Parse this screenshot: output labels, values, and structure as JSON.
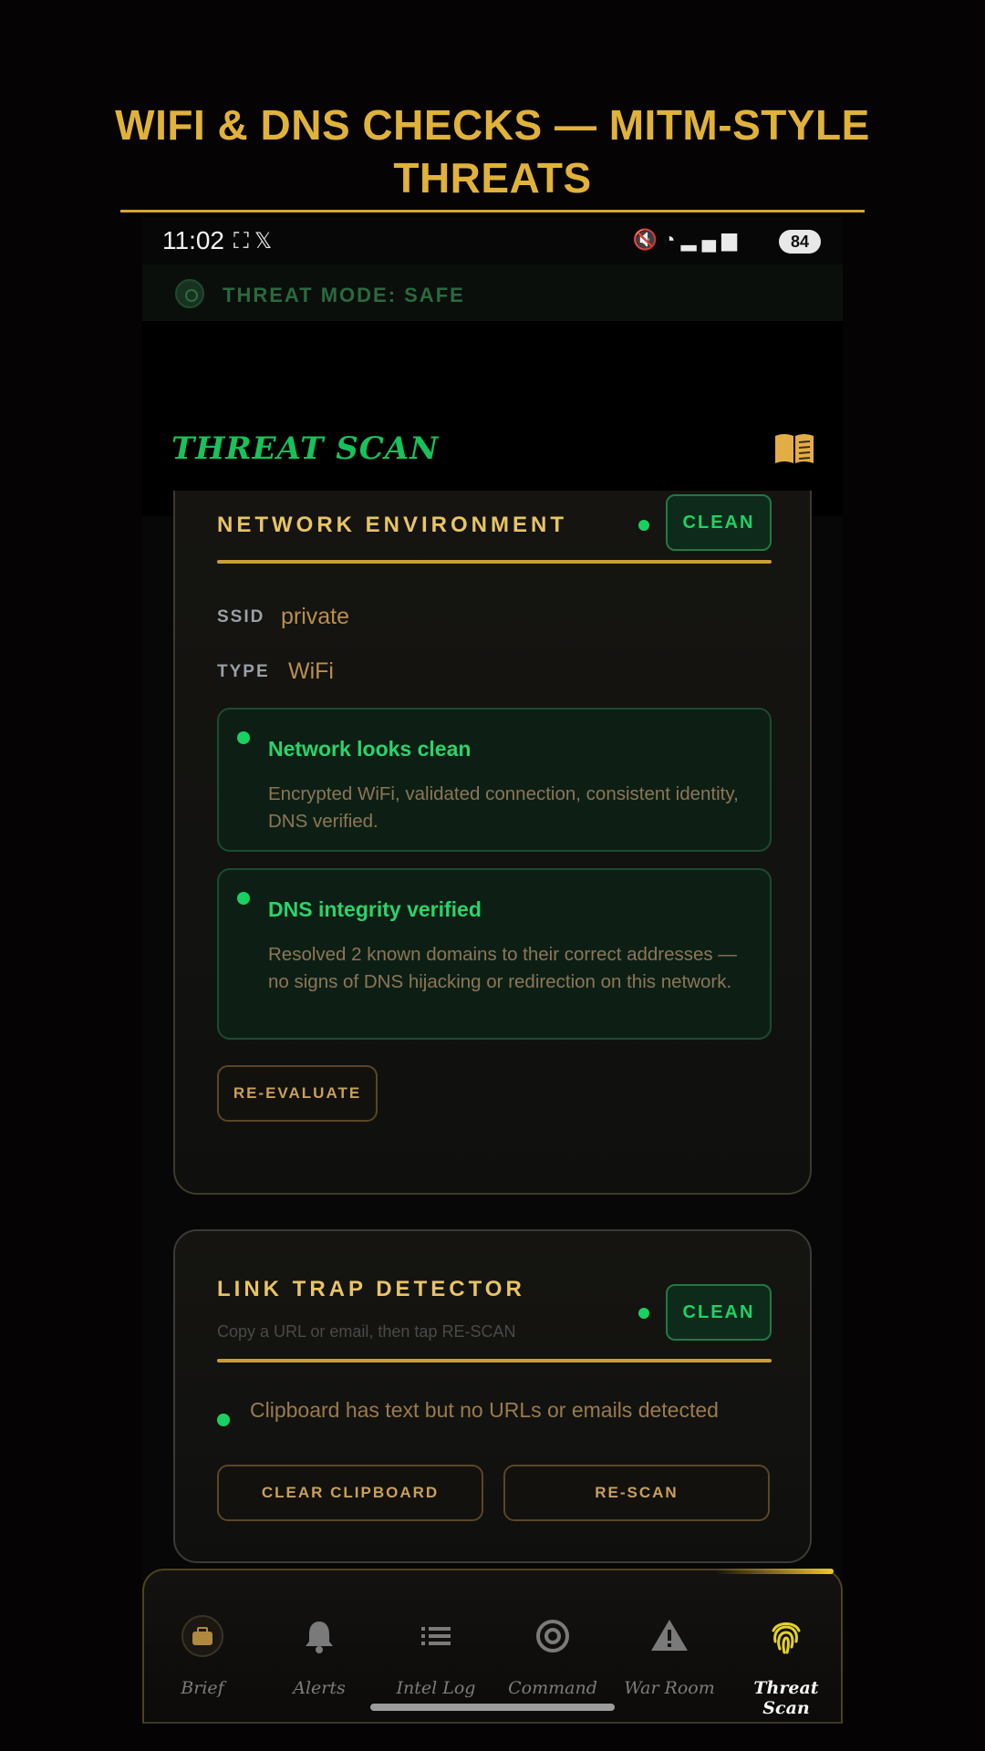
{
  "promo": {
    "title": "WIFI & DNS CHECKS — MITM-STYLE THREATS"
  },
  "statusbar": {
    "time": "11:02",
    "battery": "84"
  },
  "threat_mode": {
    "label": "THREAT MODE: SAFE"
  },
  "header": {
    "brand": "THREAT SCAN",
    "icon": "book-icon"
  },
  "network_card": {
    "title": "NETWORK ENVIRONMENT",
    "badge": "CLEAN",
    "ssid_label": "SSID",
    "ssid_value": "private",
    "type_label": "TYPE",
    "type_value": "WiFi",
    "checks": [
      {
        "title": "Network looks clean",
        "body": "Encrypted WiFi, validated connection, consistent identity, DNS verified."
      },
      {
        "title": "DNS integrity verified",
        "body": "Resolved 2 known domains to their correct addresses — no signs of DNS hijacking or redirection on this network."
      }
    ],
    "reevaluate_label": "RE-EVALUATE"
  },
  "link_card": {
    "title": "LINK TRAP DETECTOR",
    "subtitle": "Copy a URL or email, then tap RE-SCAN",
    "badge": "CLEAN",
    "message": "Clipboard has text but no URLs or emails detected",
    "clear_label": "CLEAR CLIPBOARD",
    "rescan_label": "RE-SCAN"
  },
  "tabs": [
    {
      "label": "Brief",
      "icon": "briefcase-icon"
    },
    {
      "label": "Alerts",
      "icon": "bell-icon"
    },
    {
      "label": "Intel Log",
      "icon": "list-icon"
    },
    {
      "label": "Command",
      "icon": "at-sign-icon"
    },
    {
      "label": "War Room",
      "icon": "warning-icon"
    },
    {
      "label": "Threat Scan",
      "icon": "fingerprint-icon",
      "active": true
    }
  ],
  "colors": {
    "gold": "#e0b23a",
    "green": "#19d160",
    "background": "#050303"
  }
}
